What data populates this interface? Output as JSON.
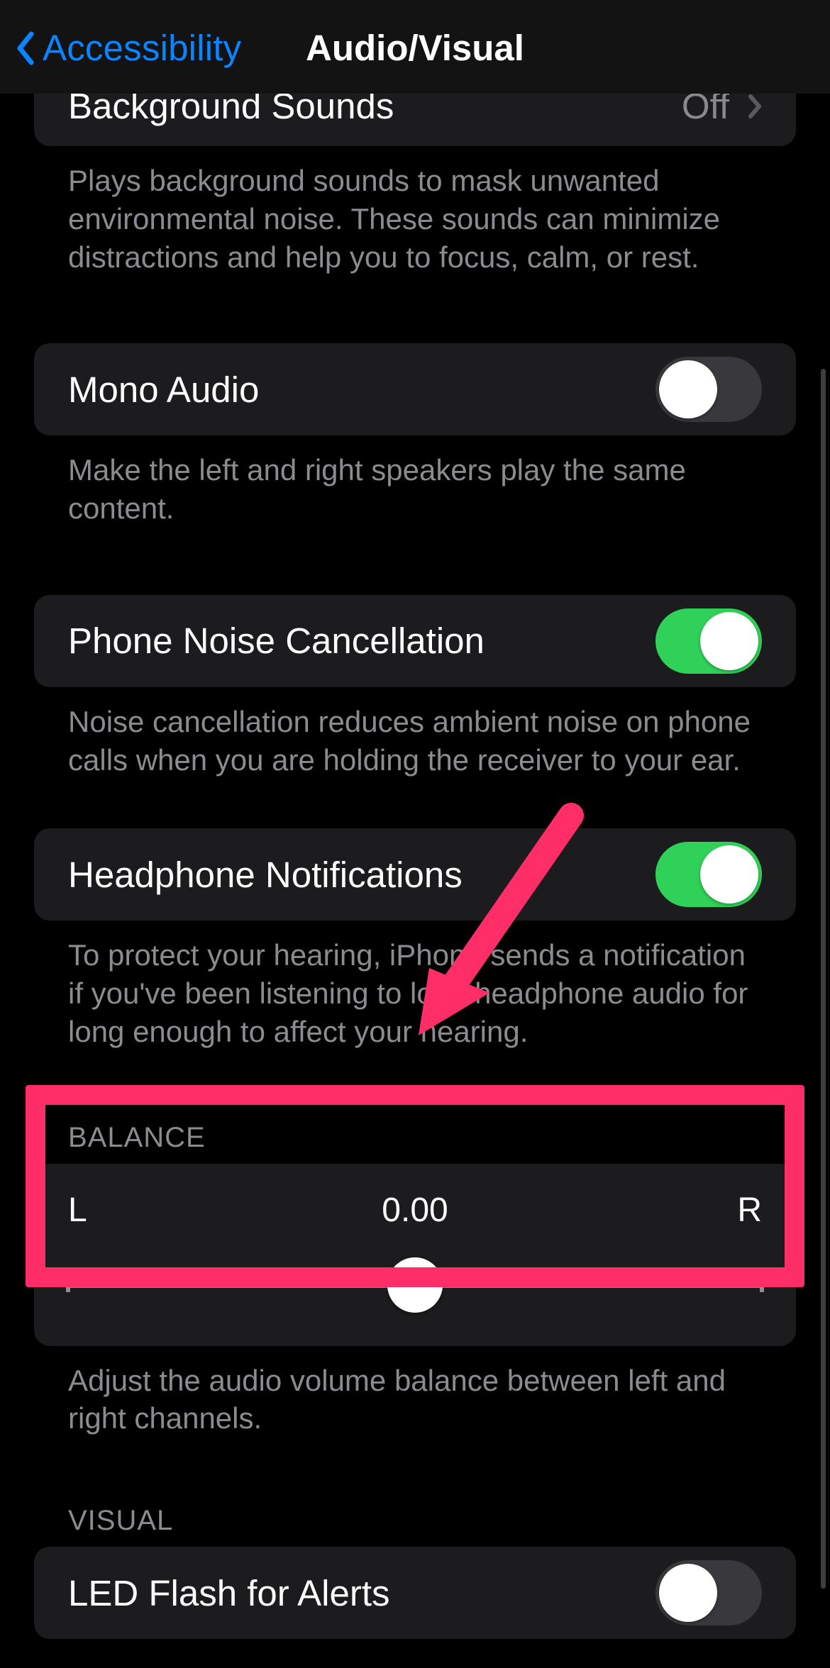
{
  "nav": {
    "back_label": "Accessibility",
    "title": "Audio/Visual"
  },
  "rows": {
    "background_sounds": {
      "label": "Background Sounds",
      "value": "Off",
      "footer": "Plays background sounds to mask unwanted environmental noise. These sounds can minimize distractions and help you to focus, calm, or rest."
    },
    "mono_audio": {
      "label": "Mono Audio",
      "on": false,
      "footer": "Make the left and right speakers play the same content."
    },
    "phone_noise_cancellation": {
      "label": "Phone Noise Cancellation",
      "on": true,
      "footer": "Noise cancellation reduces ambient noise on phone calls when you are holding the receiver to your ear."
    },
    "headphone_notifications": {
      "label": "Headphone Notifications",
      "on": true,
      "footer": "To protect your hearing, iPhone sends a notification if you've been listening to loud headphone audio for long enough to affect your hearing."
    },
    "led_flash": {
      "label": "LED Flash for Alerts",
      "on": false
    }
  },
  "balance": {
    "header": "BALANCE",
    "left": "L",
    "right": "R",
    "value": "0.00",
    "footer": "Adjust the audio volume balance between left and right channels."
  },
  "visual_header": "VISUAL",
  "annotation": {
    "highlight_color": "#ff2d68"
  }
}
